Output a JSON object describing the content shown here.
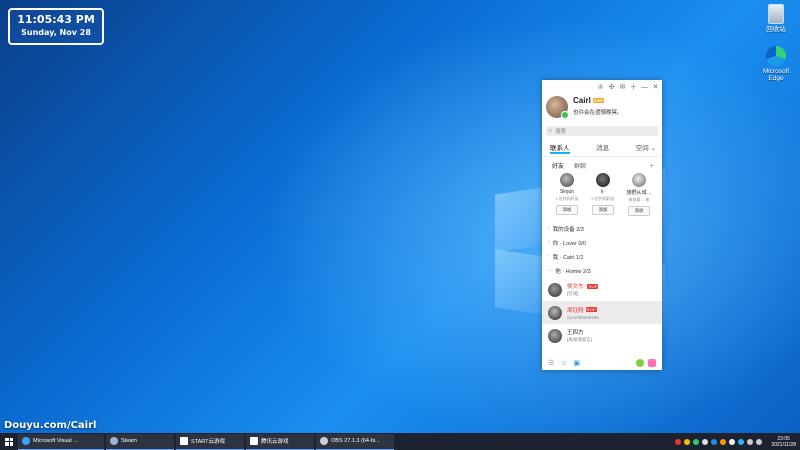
{
  "clock": {
    "time": "11:05:43 PM",
    "date": "Sunday, Nov 28"
  },
  "desktop_icons": [
    {
      "label": "回收站",
      "icon": "recycle-bin-icon"
    },
    {
      "label": "Microsoft Edge",
      "icon": "edge-icon"
    }
  ],
  "watermark": "Douyu.com/Cairl",
  "qq": {
    "titlebar_icons": [
      "shirt-icon",
      "puzzle-icon",
      "mail-icon",
      "add-icon",
      "minimize-icon",
      "close-icon"
    ],
    "titlebar_glyphs": [
      "♔",
      "✣",
      "✉",
      "＋",
      "—",
      "✕"
    ],
    "profile": {
      "name": "Cairl",
      "level_badge": "SVIP",
      "signature": "也许会在遗憾晚冥。"
    },
    "search_placeholder": "搜索",
    "tabs": [
      "联系人",
      "消息",
      "空间"
    ],
    "sub_tabs": [
      "好友",
      "群聊"
    ],
    "recommend": [
      {
        "name": "Skrjun",
        "mutual": "1 位共同好友",
        "add": "添加"
      },
      {
        "name": "k·",
        "mutual": "2 位共同好友",
        "add": "添加"
      },
      {
        "name": "旅野从城…",
        "mutual": "来自群… 来",
        "add": "添加"
      }
    ],
    "groups": [
      {
        "label": "我的设备 2/3",
        "expanded": false
      },
      {
        "label": "你 · Lover 0/0",
        "expanded": false
      },
      {
        "label": "我 · Cairl 1/1",
        "expanded": false
      },
      {
        "label": "他 · Homie 2/3",
        "expanded": true
      }
    ],
    "contacts": [
      {
        "name": "侯文杰·",
        "badge": "SVIP",
        "status": "[在线]",
        "selected": false,
        "vip": true
      },
      {
        "name": "周钰翔",
        "badge": "SVIP",
        "status": "",
        "selected": true,
        "vip": true
      },
      {
        "name": "王四方",
        "badge": "",
        "status": "[离线请留言]",
        "selected": false,
        "vip": false
      }
    ],
    "contact2_extra": "zyx1066348195"
  },
  "taskbar": {
    "items": [
      {
        "label": "Microsoft Visual ...",
        "icon": "visual-studio-icon",
        "color": "#3ea0ff"
      },
      {
        "label": "Steam",
        "icon": "steam-icon",
        "color": "#9fb6d1"
      },
      {
        "label": "START云游戏",
        "icon": "start-cloud-game-icon",
        "color": "#ffffff"
      },
      {
        "label": "腾讯云游戏",
        "icon": "tencent-cloud-game-icon",
        "color": "#ffffff"
      },
      {
        "label": "OBS 27.1.3 (64-bi...",
        "icon": "obs-icon",
        "color": "#cfcfcf"
      }
    ],
    "time": "23:05",
    "date": "2021/11/28"
  }
}
